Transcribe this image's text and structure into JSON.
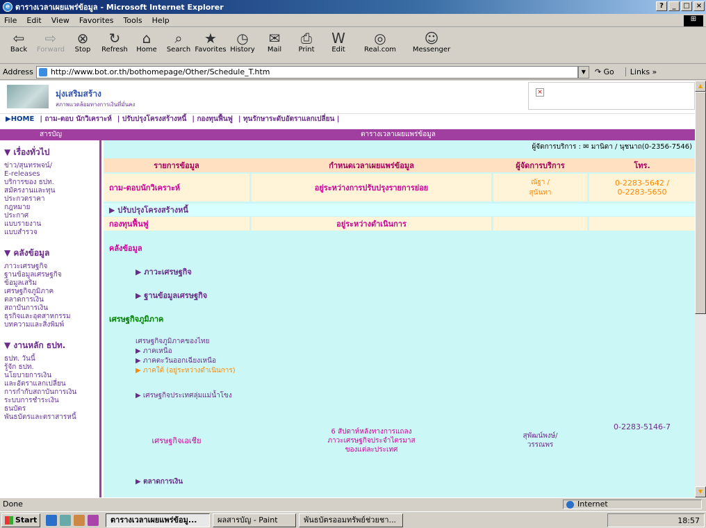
{
  "window": {
    "title": "ตารางเวลาเผยแพร่ข้อมูล - Microsoft Internet Explorer",
    "controls": [
      "?",
      "_",
      "□",
      "×"
    ]
  },
  "menu": [
    "File",
    "Edit",
    "View",
    "Favorites",
    "Tools",
    "Help"
  ],
  "toolbar": [
    {
      "label": "Back",
      "icon": "⇦",
      "name": "back"
    },
    {
      "label": "Forward",
      "icon": "⇨",
      "name": "forward"
    },
    {
      "label": "Stop",
      "icon": "⊗",
      "name": "stop"
    },
    {
      "label": "Refresh",
      "icon": "↻",
      "name": "refresh"
    },
    {
      "label": "Home",
      "icon": "⌂",
      "name": "home"
    },
    {
      "label": "Search",
      "icon": "⌕",
      "name": "search"
    },
    {
      "label": "Favorites",
      "icon": "★",
      "name": "favorites"
    },
    {
      "label": "History",
      "icon": "◷",
      "name": "history"
    },
    {
      "label": "Mail",
      "icon": "✉",
      "name": "mail"
    },
    {
      "label": "Print",
      "icon": "⎙",
      "name": "print"
    },
    {
      "label": "Edit",
      "icon": "W",
      "name": "edit"
    },
    {
      "label": "Real.com",
      "icon": "◎",
      "name": "realcom"
    },
    {
      "label": "Messenger",
      "icon": "☺",
      "name": "messenger"
    }
  ],
  "address": {
    "label": "Address",
    "url": "http://www.bot.or.th/bothomepage/Other/Schedule_T.htm",
    "go": "Go",
    "links": "Links"
  },
  "banner": {
    "title": "มุ่งเสริมสร้าง",
    "subtitle": "สภาพแวดล้อมทางการเงินที่มั่นคง"
  },
  "topnav": [
    "▶HOME",
    "| ถาม-ตอบ นักวิเคราะห์",
    "| ปรับปรุงโครงสร้างหนี้",
    "| กองทุนฟื้นฟู",
    "| ทุนรักษาระดับอัตราแลกเปลี่ยน |"
  ],
  "side_header": "สารบัญ",
  "main_header": "ตารางเวลาเผยแพร่ข้อมูล",
  "sidebar": [
    {
      "title": "▼ เรื่องทั่วไป",
      "items": [
        "ข่าว/สุนทรพจน์/",
        "E-releases",
        "บริการของ ธปท.",
        "สมัครงานและทุน",
        "ประกวดราคา",
        "กฎหมาย",
        "ประกาศ",
        "แบบรายงาน",
        "แบบสำรวจ"
      ]
    },
    {
      "title": "▼ คลังข้อมูล",
      "items": [
        "ภาวะเศรษฐกิจ",
        "ฐานข้อมูลเศรษฐกิจ",
        "ข้อมูลเสริม",
        "เศรษฐกิจภูมิภาค",
        "ตลาดการเงิน",
        "สถาบันการเงิน",
        "ธุรกิจและอุตสาหกรรม",
        "บทความและสิ่งพิมพ์"
      ]
    },
    {
      "title": "▼ งานหลัก ธปท.",
      "items": [
        "ธปท. วันนี้",
        "รู้จัก ธปท.",
        "นโยบายการเงิน",
        "และอัตราแลกเปลี่ยน",
        "การกำกับสถาบันการเงิน",
        "ระบบการชำระเงิน",
        "ธนบัตร",
        "พันธบัตรและตราสารหนี้"
      ]
    }
  ],
  "contact": "ผู้จัดการบริการ : ✉ มานิดา / นุชนาถ(0-2356-7546)",
  "table_header": [
    "รายการข้อมูล",
    "กำหนดเวลาเผยแพร่ข้อมูล",
    "ผู้จัดการบริการ",
    "โทร."
  ],
  "row1": {
    "item": "ถาม-ตอบนักวิเคราะห์",
    "schedule": "อยู่ระหว่างการปรับปรุงรายการย่อย",
    "manager": "ณัฐา /\nสุนันทา",
    "tel": "0-2283-5642 /\n0-2283-5650"
  },
  "row2": {
    "item": "▶ ปรับปรุงโครงสร้างหนี้"
  },
  "row3": {
    "item": "กองทุนฟื้นฟู",
    "schedule": "อยู่ระหว่างดำเนินการ"
  },
  "blocks": {
    "klang": "คลังข้อมูล",
    "phawa": "▶ ภาวะเศรษฐกิจ",
    "than": "▶ ฐานข้อมูลเศรษฐกิจ",
    "region_title": "เศรษฐกิจภูมิภาค",
    "region_th": "เศรษฐกิจภูมิภาคของไทย",
    "north": "▶ ภาคเหนือ",
    "northeast": "▶ ภาคตะวันออกเฉียงเหนือ",
    "south": "▶ ภาคใต้  (อยู่ระหว่างดำเนินการ)",
    "mekong": "▶ เศรษฐกิจประเทศลุ่มแม่น้ำโขง",
    "market": "▶ ตลาดการเงิน"
  },
  "row4": {
    "item": "เศรษฐกิจเอเชีย",
    "schedule": [
      "6 สัปดาห์หลังทางการแถลง",
      "ภาวะเศรษฐกิจประจำไตรมาส",
      "ของแต่ละประเทศ"
    ],
    "manager": [
      "สุพัฒน์พงษ์/",
      "วรรณพร"
    ],
    "tel": "0-2283-5146-7"
  },
  "status": {
    "text": "Done",
    "zone": "Internet"
  },
  "taskbar": {
    "start": "Start",
    "tasks": [
      "ตารางเวลาเผยแพร่ข้อมู...",
      "ผลสารบัญ - Paint",
      "พันธบัตรออมทรัพย์ช่วยชา..."
    ],
    "clock": "18:57"
  }
}
